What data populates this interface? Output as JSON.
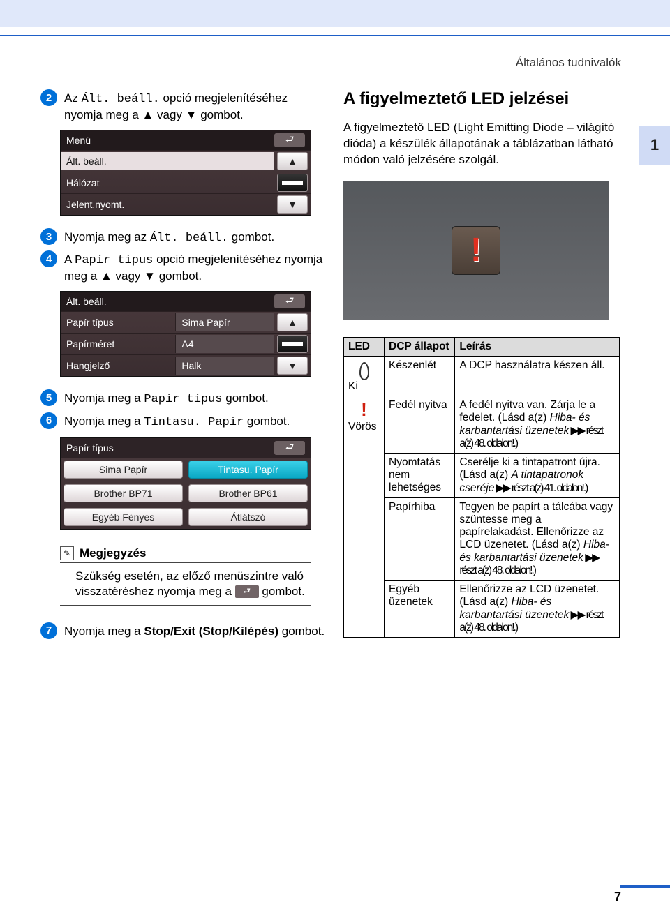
{
  "header_text": "Általános tudnivalók",
  "side_tab": "1",
  "page_num": "7",
  "steps": {
    "s2": {
      "n": "2",
      "a": "Az ",
      "code": "Ált. beáll.",
      "b": " opció megjelenítéséhez nyomja meg a ▲ vagy ▼ gombot."
    },
    "s3": {
      "n": "3",
      "a": "Nyomja meg az ",
      "code": "Ált. beáll.",
      "b": " gombot."
    },
    "s4": {
      "n": "4",
      "a": "A ",
      "code": "Papír típus",
      "b": " opció megjelenítéséhez nyomja meg a ▲ vagy ▼ gombot."
    },
    "s5": {
      "n": "5",
      "a": "Nyomja meg a ",
      "code": "Papír típus",
      "b": " gombot."
    },
    "s6": {
      "n": "6",
      "a": "Nyomja meg a ",
      "code": "Tintasu. Papír",
      "b": " gombot."
    },
    "s7": {
      "n": "7",
      "a": "Nyomja meg a ",
      "bold": "Stop/Exit (Stop/Kilépés)",
      "b": " gombot."
    }
  },
  "lcd1": {
    "title": "Menü",
    "r1": "Ált. beáll.",
    "r2": "Hálózat",
    "r3": "Jelent.nyomt."
  },
  "lcd2": {
    "title": "Ált. beáll.",
    "r1a": "Papír típus",
    "r1b": "Sima Papír",
    "r2a": "Papírméret",
    "r2b": "A4",
    "r3a": "Hangjelző",
    "r3b": "Halk"
  },
  "lcd3": {
    "title": "Papír típus",
    "o1": "Sima Papír",
    "o2": "Tintasu. Papír",
    "o3": "Brother BP71",
    "o4": "Brother BP61",
    "o5": "Egyéb Fényes",
    "o6": "Átlátszó"
  },
  "note": {
    "title": "Megjegyzés",
    "body_a": "Szükség esetén, az előző menüszintre való visszatéréshez nyomja meg a ",
    "body_b": " gombot."
  },
  "right": {
    "title": "A figyelmeztető LED jelzései",
    "para": "A figyelmeztető LED (Light Emitting Diode – világító dióda) a készülék állapotának a táblázatban látható módon való jelzésére szolgál."
  },
  "table": {
    "h1": "LED",
    "h2": "DCP állapot",
    "h3": "Leírás",
    "off_label": "Ki",
    "red_label": "Vörös",
    "r1s": "Készenlét",
    "r1d": "A DCP használatra készen áll.",
    "r2s": "Fedél nyitva",
    "r2d_a": "A fedél nyitva van. Zárja le a fedelet. (Lásd a(z) ",
    "r2d_i": "Hiba- és karbantartási üzenetek",
    "r2d_b": " ▶▶ részt a(z) 48. oldalon!.)",
    "r3s": "Nyomtatás nem lehetséges",
    "r3d_a": "Cserélje ki a tintapatront újra. (Lásd a(z) ",
    "r3d_i": "A tintapatronok cseréje",
    "r3d_b": " ▶▶ részt a(z) 41. oldalon!.)",
    "r4s": "Papírhiba",
    "r4d_a": "Tegyen be papírt a tálcába vagy szüntesse meg a papírelakadást. Ellenőrizze az LCD üzenetet. (Lásd a(z) ",
    "r4d_i": "Hiba- és karbantartási üzenetek",
    "r4d_b": " ▶▶ részt a(z) 48. oldalon!.)",
    "r5s": "Egyéb üzenetek",
    "r5d_a": "Ellenőrizze az LCD üzenetet. (Lásd a(z) ",
    "r5d_i": "Hiba- és karbantartási üzenetek",
    "r5d_b": " ▶▶ részt a(z) 48. oldalon!.)"
  }
}
